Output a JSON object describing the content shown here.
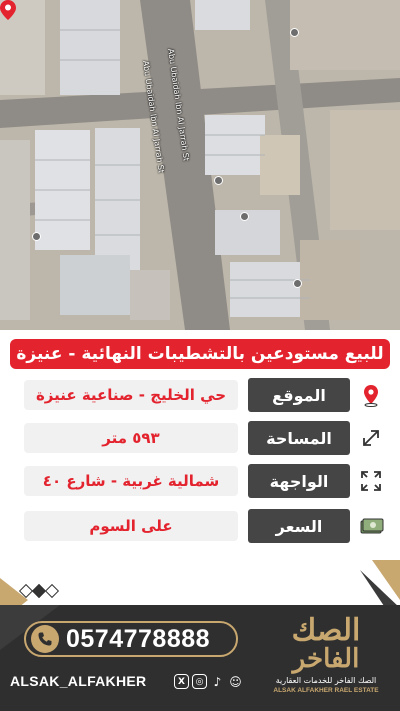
{
  "map": {
    "street_labels": [
      "Abu Ubaidah Ibn Al Jarrah St",
      "Abu Ubaidah Ibn Al Jarrah St"
    ],
    "pin_icon": "location-pin-icon"
  },
  "title": "للبيع مستودعين بالتشطيبات النهائية - عنيزة",
  "rows": [
    {
      "label": "الموقع",
      "value": "حي الخليج - صناعية عنيزة",
      "icon": "location-pin-icon"
    },
    {
      "label": "المساحة",
      "value": "٥٩٣ متر",
      "icon": "resize-arrow-icon"
    },
    {
      "label": "الواجهة",
      "value": "شمالية غربية - شارع ٤٠",
      "icon": "expand-corners-icon"
    },
    {
      "label": "السعر",
      "value": "على السوم",
      "icon": "cash-icon"
    }
  ],
  "contact": {
    "phone": "0574778888",
    "handle": "ALSAK_ALFAKHER"
  },
  "logo": {
    "mark_line1": "الصك",
    "mark_line2": "الفاخر",
    "arabic_name": "الصك الفاخر للخدمات العقارية",
    "english_name": "ALSAK ALFAKHER RAEL ESTATE"
  },
  "colors": {
    "accent_red": "#e3232e",
    "label_dark": "#454545",
    "gold": "#c9a870",
    "footer_dark": "#2f2f2f"
  }
}
